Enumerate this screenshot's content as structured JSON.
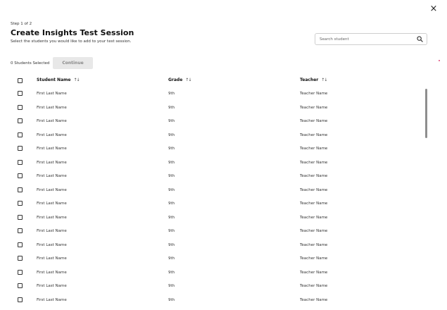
{
  "dialog": {
    "step": "Step 1 of 2",
    "title": "Create Insights Test Session",
    "subtitle": "Select the students you would like to add to your test session.",
    "close_label": "×",
    "close_icon": "close-icon"
  },
  "search": {
    "placeholder": "Search student",
    "icon": "search-icon"
  },
  "selection": {
    "count_text": "0 Students Selected",
    "continue_label": "Continue"
  },
  "table": {
    "columns": [
      {
        "label": "Student Name",
        "sort_icon": "sort-icon"
      },
      {
        "label": "Grade",
        "sort_icon": "sort-icon"
      },
      {
        "label": "Teacher",
        "sort_icon": "sort-icon"
      }
    ],
    "rows": [
      {
        "name": "First Last Name",
        "grade": "9th",
        "teacher": "Teacher Name"
      },
      {
        "name": "First Last Name",
        "grade": "9th",
        "teacher": "Teacher Name"
      },
      {
        "name": "First Last Name",
        "grade": "9th",
        "teacher": "Teacher Name"
      },
      {
        "name": "First Last Name",
        "grade": "9th",
        "teacher": "Teacher Name"
      },
      {
        "name": "First Last Name",
        "grade": "9th",
        "teacher": "Teacher Name"
      },
      {
        "name": "First Last Name",
        "grade": "9th",
        "teacher": "Teacher Name"
      },
      {
        "name": "First Last Name",
        "grade": "9th",
        "teacher": "Teacher Name"
      },
      {
        "name": "First Last Name",
        "grade": "9th",
        "teacher": "Teacher Name"
      },
      {
        "name": "First Last Name",
        "grade": "9th",
        "teacher": "Teacher Name"
      },
      {
        "name": "First Last Name",
        "grade": "9th",
        "teacher": "Teacher Name"
      },
      {
        "name": "First Last Name",
        "grade": "9th",
        "teacher": "Teacher Name"
      },
      {
        "name": "First Last Name",
        "grade": "9th",
        "teacher": "Teacher Name"
      },
      {
        "name": "First Last Name",
        "grade": "9th",
        "teacher": "Teacher Name"
      },
      {
        "name": "First Last Name",
        "grade": "9th",
        "teacher": "Teacher Name"
      },
      {
        "name": "First Last Name",
        "grade": "9th",
        "teacher": "Teacher Name"
      },
      {
        "name": "First Last Name",
        "grade": "9th",
        "teacher": "Teacher Name"
      }
    ]
  },
  "colors": {
    "accent": "#e0487a",
    "button_bg": "#e8e8e8",
    "button_text": "#8a8a8a",
    "scrollbar": "#8e8e8e"
  }
}
